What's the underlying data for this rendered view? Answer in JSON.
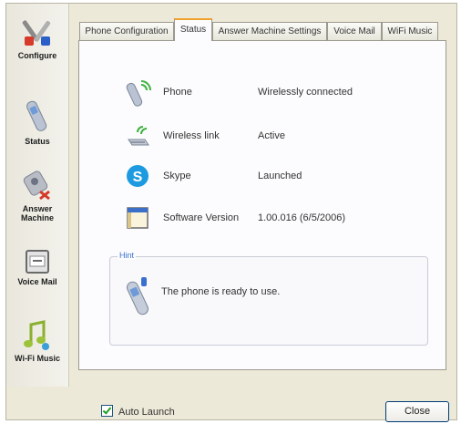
{
  "sidebar": {
    "items": [
      {
        "label": "Configure",
        "icon": "tools-icon"
      },
      {
        "label": "Status",
        "icon": "phone-icon"
      },
      {
        "label": "Answer Machine",
        "icon": "answering-machine-icon"
      },
      {
        "label": "Voice Mail",
        "icon": "voice-mail-icon"
      },
      {
        "label": "Wi-Fi Music",
        "icon": "music-icon"
      }
    ]
  },
  "tabs": [
    {
      "label": "Phone Configuration"
    },
    {
      "label": "Status"
    },
    {
      "label": "Answer Machine Settings"
    },
    {
      "label": "Voice Mail"
    },
    {
      "label": "WiFi Music"
    }
  ],
  "active_tab": "Status",
  "status": {
    "rows": [
      {
        "name": "Phone",
        "value": "Wirelessly connected",
        "icon": "phone-signal-icon"
      },
      {
        "name": "Wireless link",
        "value": "Active",
        "icon": "wireless-link-icon"
      },
      {
        "name": "Skype",
        "value": "Launched",
        "icon": "skype-icon"
      },
      {
        "name": "Software Version",
        "value": "1.00.016 (6/5/2006)",
        "icon": "software-window-icon"
      }
    ]
  },
  "hint": {
    "title": "Hint",
    "text": "The phone is ready to use."
  },
  "footer": {
    "auto_launch_label": "Auto Launch",
    "auto_launch_checked": true,
    "close_label": "Close"
  },
  "colors": {
    "tab_accent": "#f0a22d",
    "hint_title": "#3a6fcf",
    "skype_blue": "#1e9be0",
    "checkbox_tick": "#21a121"
  }
}
